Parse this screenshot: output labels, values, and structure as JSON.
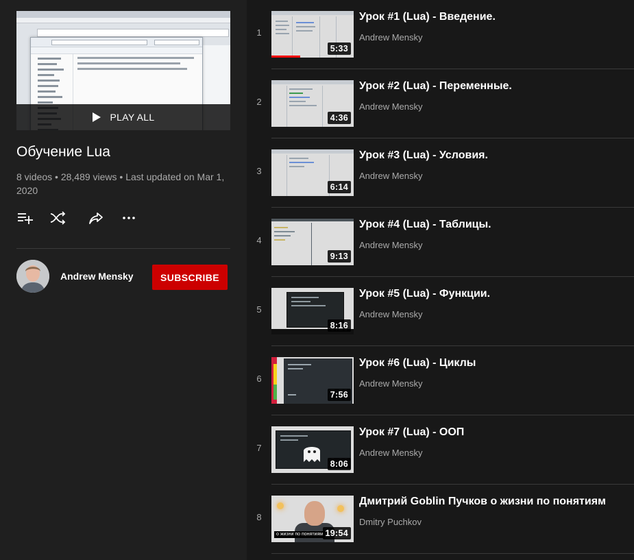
{
  "playlist": {
    "play_all_label": "PLAY ALL",
    "title": "Обучение Lua",
    "stats": "8 videos • 28,489 views • Last updated on Mar 1, 2020",
    "actions": [
      {
        "name": "save-to-playlist",
        "icon": "playlist-add-icon"
      },
      {
        "name": "shuffle",
        "icon": "shuffle-icon"
      },
      {
        "name": "share",
        "icon": "share-icon"
      },
      {
        "name": "more",
        "icon": "more-horizontal-icon"
      }
    ]
  },
  "owner": {
    "name": "Andrew Mensky",
    "subscribe_label": "SUBSCRIBE"
  },
  "colors": {
    "background": "#181818",
    "sidebar": "#1f1f1f",
    "subscribe": "#cc0000",
    "secondary_text": "#aaaaaa"
  },
  "videos": [
    {
      "index": "1",
      "title": "Урок #1 (Lua) - Введение.",
      "channel": "Andrew Mensky",
      "duration": "5:33",
      "thumb": "explorer",
      "watched": 0.35
    },
    {
      "index": "2",
      "title": "Урок #2 (Lua) - Переменные.",
      "channel": "Andrew Mensky",
      "duration": "4:36",
      "thumb": "ide-light"
    },
    {
      "index": "3",
      "title": "Урок #3 (Lua) - Условия.",
      "channel": "Andrew Mensky",
      "duration": "6:14",
      "thumb": "ide-light"
    },
    {
      "index": "4",
      "title": "Урок #4 (Lua) - Таблицы.",
      "channel": "Andrew Mensky",
      "duration": "9:13",
      "thumb": "ide-dark"
    },
    {
      "index": "5",
      "title": "Урок #5 (Lua) - Функции.",
      "channel": "Andrew Mensky",
      "duration": "8:16",
      "thumb": "desktop-terminal"
    },
    {
      "index": "6",
      "title": "Урок #6 (Lua) - Циклы",
      "channel": "Andrew Mensky",
      "duration": "7:56",
      "thumb": "terminal-stripes"
    },
    {
      "index": "7",
      "title": "Урок #7 (Lua) - ООП",
      "channel": "Andrew Mensky",
      "duration": "8:06",
      "thumb": "ghost-terminal"
    },
    {
      "index": "8",
      "title": "Дмитрий Goblin Пучков о жизни по понятиям",
      "channel": "Dmitry Puchkov",
      "duration": "19:54",
      "thumb": "interview-photo",
      "caption": "о жизни по понятиям"
    }
  ]
}
